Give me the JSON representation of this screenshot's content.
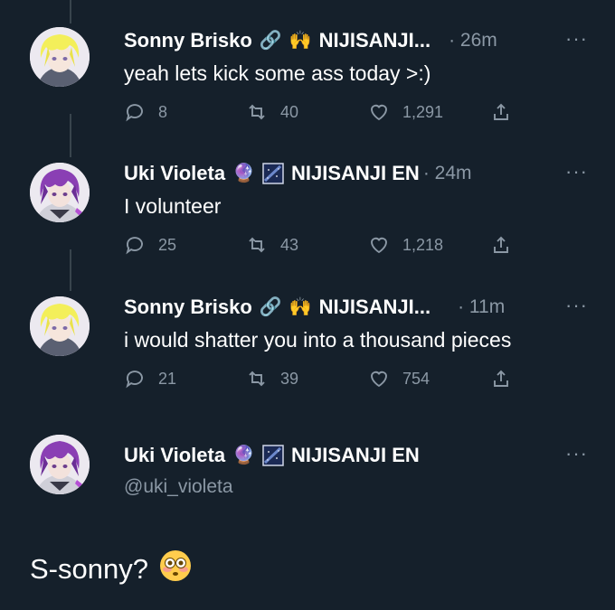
{
  "tweets": [
    {
      "name": "Sonny Brisko",
      "emojis": [
        "🔗",
        "🙌"
      ],
      "affiliation": "NIJISANJI...",
      "time": "· 26m",
      "text": "yeah lets kick some ass today >:)",
      "replies": "8",
      "retweets": "40",
      "likes": "1,291",
      "avatar": "blonde-hair-avatar"
    },
    {
      "name": "Uki Violeta",
      "emojis": [
        "🔮",
        "🌌"
      ],
      "affiliation": "NIJISANJI EN",
      "time": "· 24m",
      "text": "I volunteer",
      "replies": "25",
      "retweets": "43",
      "likes": "1,218",
      "avatar": "purple-hair-avatar"
    },
    {
      "name": "Sonny Brisko",
      "emojis": [
        "🔗",
        "🙌"
      ],
      "affiliation": "NIJISANJI...",
      "time": "· 11m",
      "text": "i would shatter you into a thousand pieces",
      "replies": "21",
      "retweets": "39",
      "likes": "754",
      "avatar": "blonde-hair-avatar"
    }
  ],
  "main_tweet": {
    "name": "Uki Violeta",
    "emojis": [
      "🔮",
      "🌌"
    ],
    "affiliation": "NIJISANJI EN",
    "handle": "@uki_violeta",
    "text": "S-sonny?",
    "emoji_after_text": "😳"
  },
  "more_label": "···",
  "colors": {
    "background": "#15202b",
    "secondary_text": "#8b98a5",
    "thread_line": "#38444d"
  }
}
